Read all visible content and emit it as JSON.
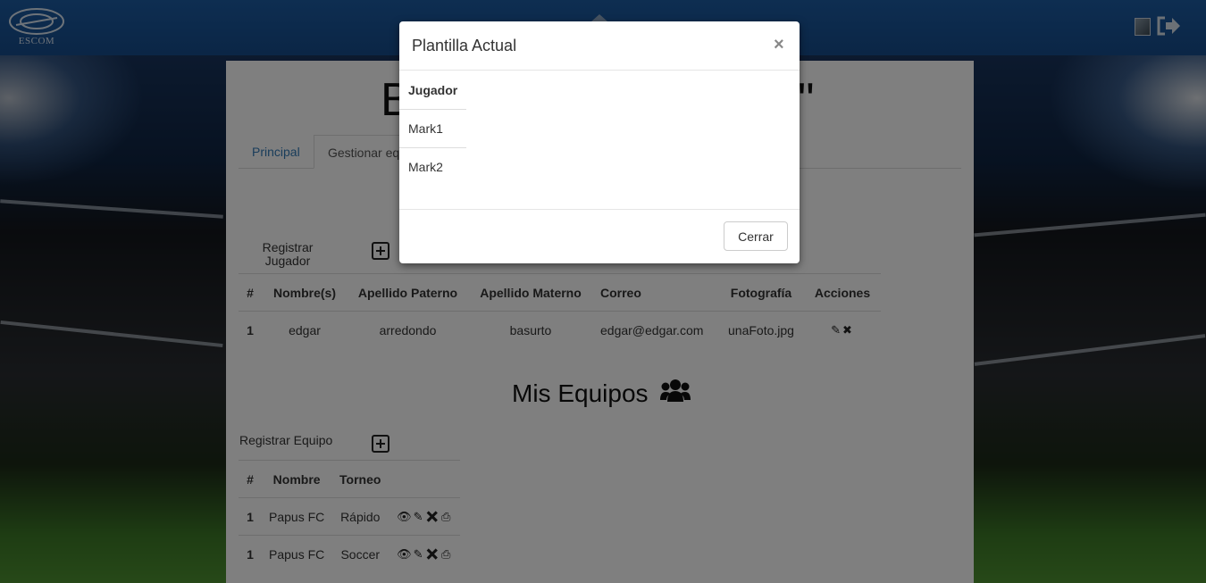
{
  "header": {
    "logo_text": "ESCOM"
  },
  "page": {
    "title_start": "B",
    "title_end": "\""
  },
  "tabs": [
    {
      "label": "Principal"
    },
    {
      "label": "Gestionar eq"
    }
  ],
  "players": {
    "register_label": "Registrar Jugador",
    "columns": [
      "#",
      "Nombre(s)",
      "Apellido Paterno",
      "Apellido Materno",
      "Correo",
      "Fotografía",
      "Acciones"
    ],
    "rows": [
      {
        "num": "1",
        "nombre": "edgar",
        "paterno": "arredondo",
        "materno": "basurto",
        "correo": "edgar@edgar.com",
        "foto": "unaFoto.jpg"
      }
    ]
  },
  "teams": {
    "section_title": "Mis Equipos",
    "register_label": "Registrar Equipo",
    "columns": [
      "#",
      "Nombre",
      "Torneo"
    ],
    "rows": [
      {
        "num": "1",
        "nombre": "Papus FC",
        "torneo": "Rápido"
      },
      {
        "num": "1",
        "nombre": "Papus FC",
        "torneo": "Soccer"
      }
    ]
  },
  "modal": {
    "title": "Plantilla Actual",
    "close_symbol": "×",
    "column": "Jugador",
    "players": [
      "Mark1",
      "Mark2"
    ],
    "button": "Cerrar"
  }
}
